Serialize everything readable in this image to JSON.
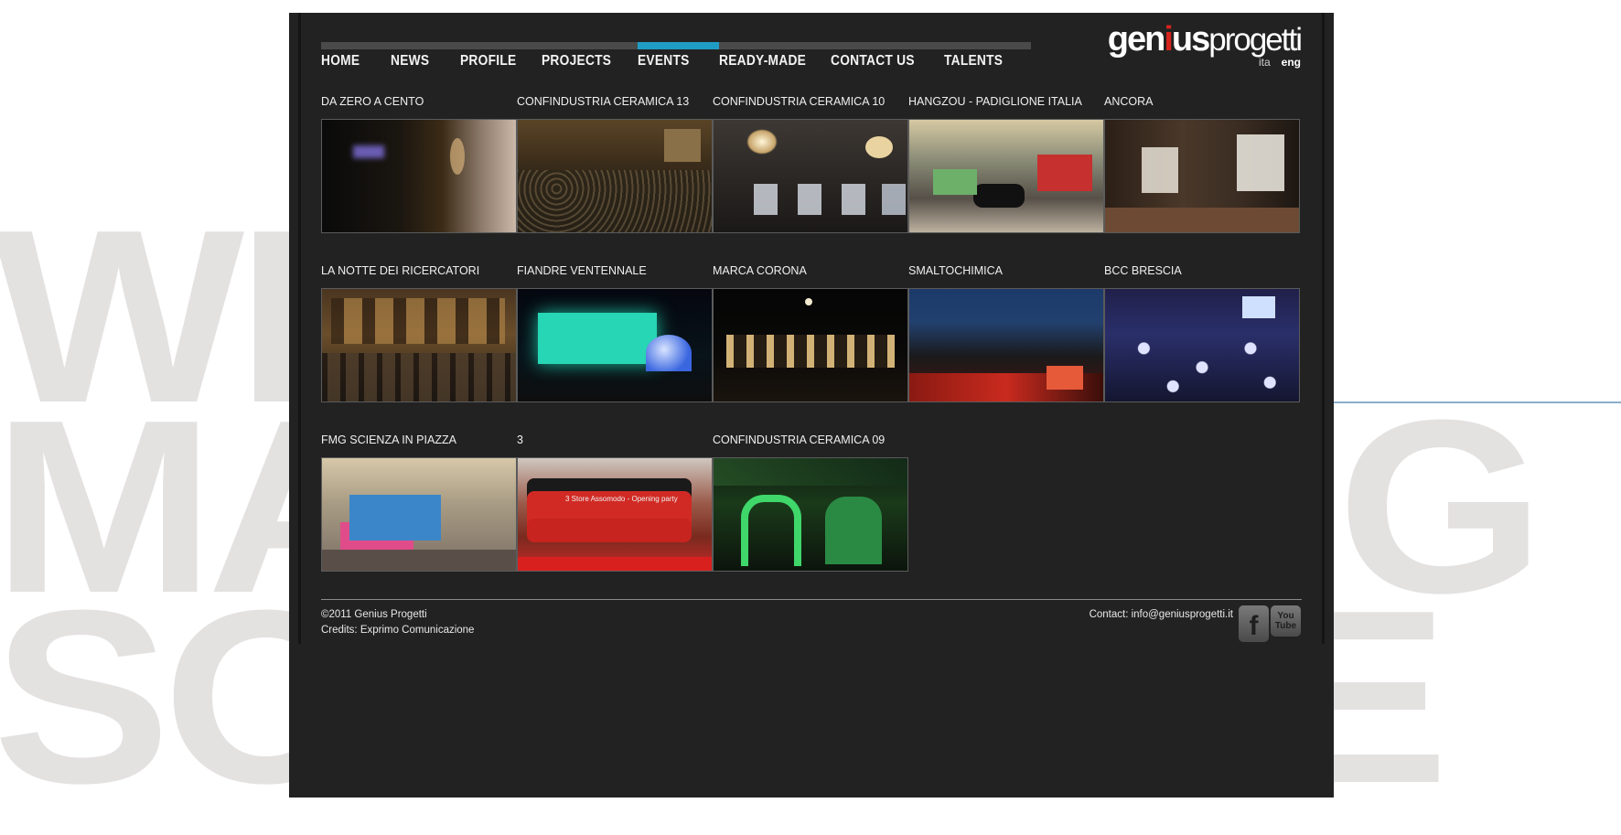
{
  "background": {
    "words": [
      "WEB",
      "MARKETING",
      "SOFTWARE"
    ]
  },
  "nav": {
    "items": [
      "HOME",
      "NEWS",
      "PROFILE",
      "PROJECTS",
      "EVENTS",
      "READY-MADE",
      "CONTACT US",
      "TALENTS"
    ],
    "active": "EVENTS"
  },
  "logo": {
    "part1": "gen",
    "part2": "i",
    "part3": "us",
    "part4": "progetti"
  },
  "lang": {
    "ita": "ita",
    "eng": "eng",
    "active": "eng"
  },
  "events": {
    "row1": [
      "DA ZERO A CENTO",
      "CONFINDUSTRIA CERAMICA 13",
      "CONFINDUSTRIA CERAMICA 10",
      "HANGZOU - PADIGLIONE ITALIA",
      "ANCORA"
    ],
    "row2": [
      "LA NOTTE DEI RICERCATORI",
      "FIANDRE VENTENNALE",
      "MARCA CORONA",
      "SMALTOCHIMICA",
      "BCC BRESCIA"
    ],
    "row3": [
      "FMG SCIENZA IN PIAZZA",
      "3",
      "CONFINDUSTRIA CERAMICA 09"
    ]
  },
  "thumbs": {
    "three_bus_text": "3 Store Assomodo - Opening party"
  },
  "footer": {
    "copyright": "©2011 Genius Progetti",
    "credits": "Credits: Exprimo Comunicazione",
    "contact": "Contact: info@geniusprogetti.it",
    "facebook_glyph": "f",
    "youtube_text_1": "You",
    "youtube_text_2": "Tube"
  },
  "colors": {
    "page_bg": "#222222",
    "accent_nav": "#1f9cc4",
    "logo_i": "#d5241e",
    "bg_type": "#e4e1e1"
  }
}
